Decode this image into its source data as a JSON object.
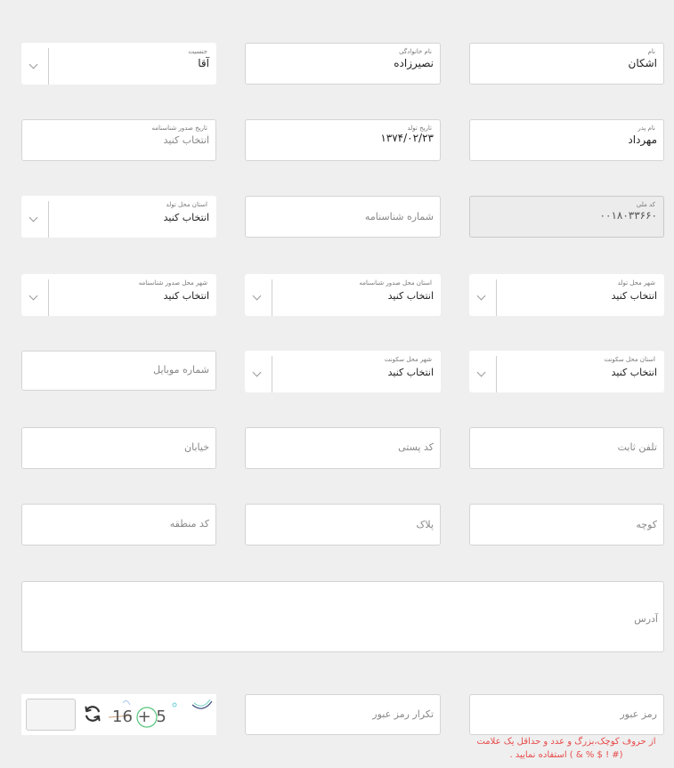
{
  "row1": {
    "first_name": {
      "label": "نام",
      "value": "اشکان"
    },
    "last_name": {
      "label": "نام خانوادگی",
      "value": "نصیرزاده"
    },
    "gender": {
      "label": "جنسیت",
      "value": "آقا"
    }
  },
  "row2": {
    "father_name": {
      "label": "نام پدر",
      "value": "مهرداد"
    },
    "birth_date": {
      "label": "تاریخ تولد",
      "value": "۱۳۷۴/۰۲/۲۳"
    },
    "id_issue_date": {
      "label": "تاریخ صدور شناسنامه",
      "placeholder": "انتخاب کنید"
    }
  },
  "row3": {
    "national_code": {
      "label": "کد ملی",
      "value": "۰۰۱۸۰۳۳۶۶۰"
    },
    "id_number": {
      "placeholder": "شماره شناسنامه"
    },
    "birth_province": {
      "label": "استان محل تولد",
      "value": "انتخاب کنید"
    }
  },
  "row4": {
    "birth_city": {
      "label": "شهر محل تولد",
      "value": "انتخاب کنید"
    },
    "issue_province": {
      "label": "استان محل صدور شناسنامه",
      "value": "انتخاب کنید"
    },
    "issue_city": {
      "label": "شهر محل صدور شناسنامه",
      "value": "انتخاب کنید"
    }
  },
  "row5": {
    "residence_province": {
      "label": "استان محل سکونت",
      "value": "انتخاب کنید"
    },
    "residence_city": {
      "label": "شهر محل سکونت",
      "value": "انتخاب کنید"
    },
    "mobile": {
      "placeholder": "شماره موبایل"
    }
  },
  "row6": {
    "phone": {
      "placeholder": "تلفن ثابت"
    },
    "postal_code": {
      "placeholder": "کد پستی"
    },
    "street": {
      "placeholder": "خیابان"
    }
  },
  "row7": {
    "alley": {
      "placeholder": "کوچه"
    },
    "plate": {
      "placeholder": "پلاک"
    },
    "area_code": {
      "placeholder": "کد منطقه"
    }
  },
  "address": {
    "placeholder": "آدرس"
  },
  "password": {
    "placeholder": "رمز عبور",
    "hint_line1": "از حروف کوچک،بزرگ و عدد و حداقل یک علامت",
    "hint_line2": "(# ! $ % & ) استفاده نمایید ."
  },
  "password_repeat": {
    "placeholder": "تکرار رمز عبور"
  },
  "captcha": {
    "text": "16 + 5",
    "refresh_icon": "refresh-icon"
  }
}
